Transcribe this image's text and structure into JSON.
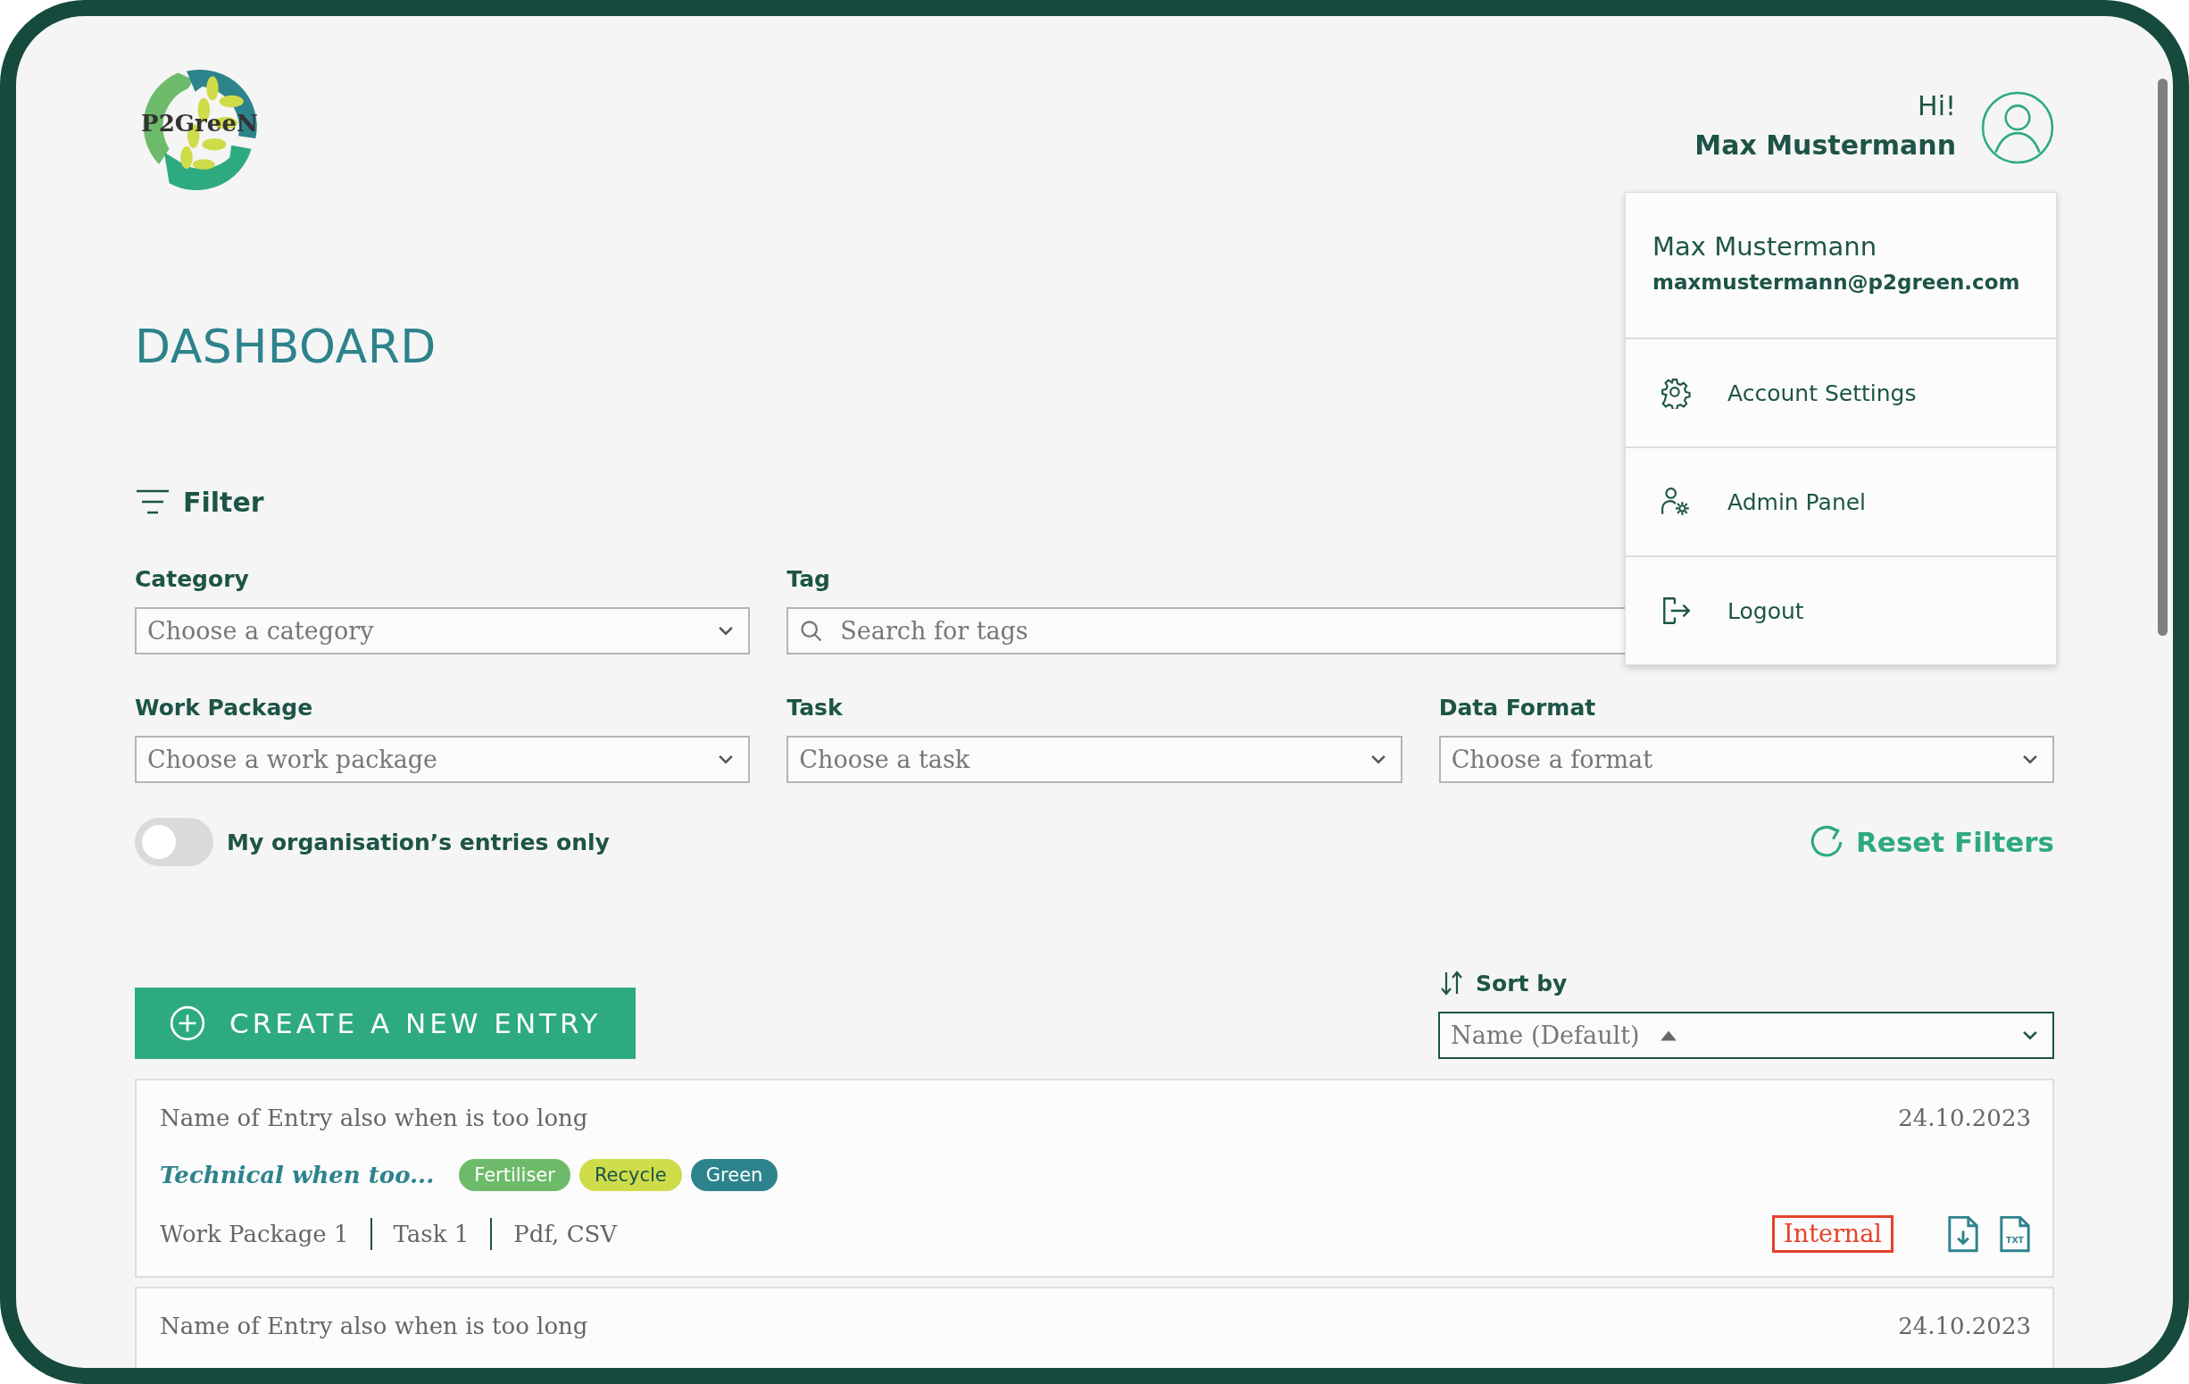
{
  "header": {
    "logo_text": "P2GreeN",
    "greeting": "Hi!",
    "user_name": "Max Mustermann"
  },
  "user_menu": {
    "open": true,
    "name": "Max Mustermann",
    "email": "maxmustermann@p2green.com",
    "items": [
      {
        "kind": "settings",
        "label": "Account Settings"
      },
      {
        "kind": "admin",
        "label": "Admin Panel"
      },
      {
        "kind": "logout",
        "label": "Logout"
      }
    ]
  },
  "page_title": "DASHBOARD",
  "filter": {
    "title": "Filter",
    "rows": [
      [
        {
          "kind": "select",
          "label": "Category",
          "placeholder": "Choose a category"
        },
        {
          "kind": "search",
          "label": "Tag",
          "placeholder": "Search for tags"
        }
      ],
      [
        {
          "kind": "select",
          "label": "Work Package",
          "placeholder": "Choose a work package"
        },
        {
          "kind": "select",
          "label": "Task",
          "placeholder": "Choose a task"
        },
        {
          "kind": "select",
          "label": "Data Format",
          "placeholder": "Choose a format"
        }
      ]
    ],
    "toggle": {
      "label": "My organisation’s entries only",
      "on": false
    },
    "reset": "Reset Filters"
  },
  "create_button": "CREATE A NEW ENTRY",
  "sort": {
    "label": "Sort by",
    "value": "Name (Default)"
  },
  "entries": [
    {
      "name": "Name of Entry also when is too long",
      "date": "24.10.2023",
      "category": "Technical when too...",
      "tags": [
        {
          "label": "Fertiliser",
          "color": "#6dbb6a"
        },
        {
          "label": "Recycle",
          "color": "#cfdc4a"
        },
        {
          "label": "Green",
          "color": "#2d838c"
        }
      ],
      "meta": [
        "Work Package 1",
        "Task 1",
        "Pdf, CSV"
      ],
      "visibility": "Internal",
      "txt_icon_label": "TXT"
    },
    {
      "name": "Name of Entry also when is too long",
      "date": "24.10.2023"
    }
  ]
}
